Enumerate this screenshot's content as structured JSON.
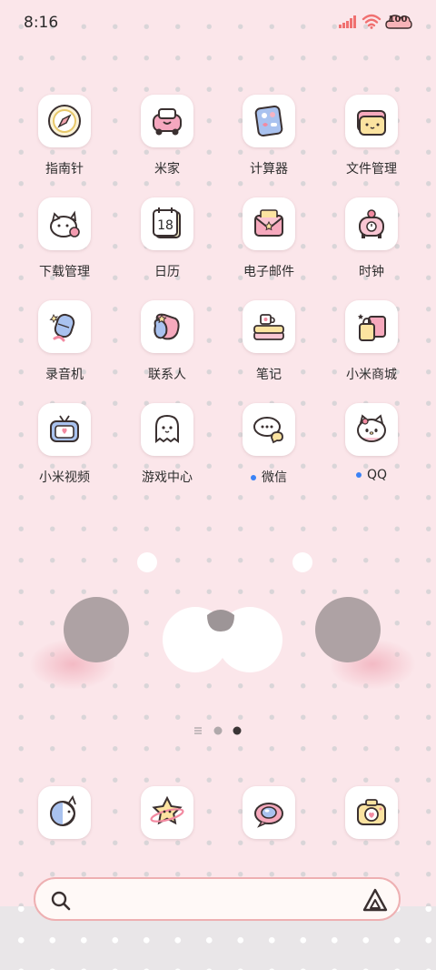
{
  "status": {
    "time": "8:16",
    "battery": "100"
  },
  "apps": [
    {
      "label": "指南针",
      "icon": "compass-icon"
    },
    {
      "label": "米家",
      "icon": "mijia-icon"
    },
    {
      "label": "计算器",
      "icon": "calculator-icon"
    },
    {
      "label": "文件管理",
      "icon": "file-manager-icon"
    },
    {
      "label": "下载管理",
      "icon": "download-manager-icon"
    },
    {
      "label": "日历",
      "icon": "calendar-icon",
      "date": "18"
    },
    {
      "label": "电子邮件",
      "icon": "email-icon"
    },
    {
      "label": "时钟",
      "icon": "clock-icon"
    },
    {
      "label": "录音机",
      "icon": "recorder-icon"
    },
    {
      "label": "联系人",
      "icon": "contacts-icon"
    },
    {
      "label": "笔记",
      "icon": "notes-icon"
    },
    {
      "label": "小米商城",
      "icon": "mi-store-icon"
    },
    {
      "label": "小米视频",
      "icon": "mi-video-icon"
    },
    {
      "label": "游戏中心",
      "icon": "game-center-icon"
    },
    {
      "label": "微信",
      "icon": "wechat-icon",
      "new_badge": true
    },
    {
      "label": "QQ",
      "icon": "qq-icon",
      "new_badge": true
    }
  ],
  "dock": [
    {
      "icon": "phone-icon"
    },
    {
      "icon": "messages-icon"
    },
    {
      "icon": "browser-icon"
    },
    {
      "icon": "camera-icon"
    }
  ],
  "colors": {
    "background": "#fbe6ea",
    "badge_dot": "#3b82f6",
    "search_border": "#eeb0b2"
  }
}
